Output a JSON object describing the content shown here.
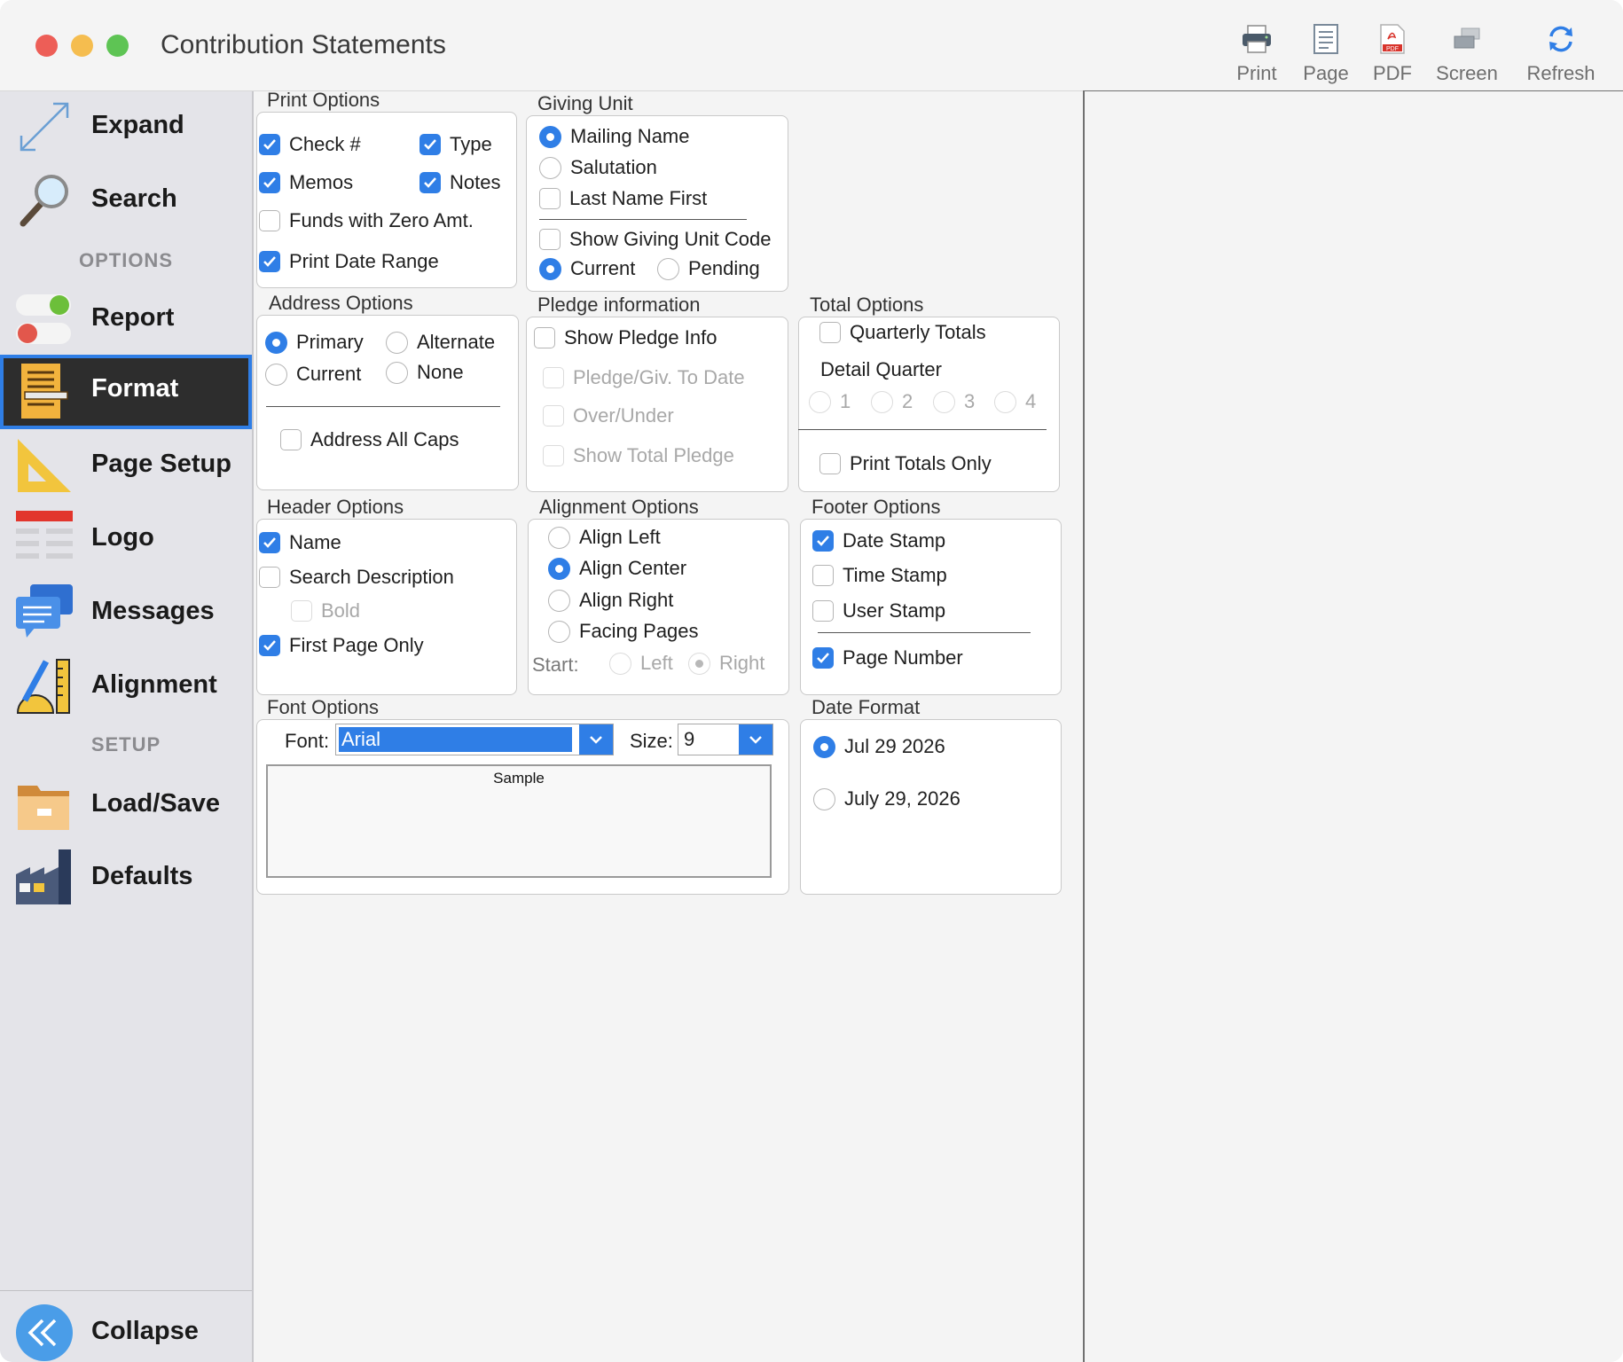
{
  "window": {
    "title": "Contribution Statements"
  },
  "toolbar": {
    "print": "Print",
    "page": "Page",
    "pdf": "PDF",
    "pdf_badge": "PDF",
    "screen": "Screen",
    "refresh": "Refresh"
  },
  "sidebar": {
    "expand": "Expand",
    "search": "Search",
    "options_header": "OPTIONS",
    "report": "Report",
    "format": "Format",
    "page_setup": "Page Setup",
    "logo": "Logo",
    "messages": "Messages",
    "alignment": "Alignment",
    "setup_header": "SETUP",
    "load_save": "Load/Save",
    "defaults": "Defaults",
    "collapse": "Collapse"
  },
  "print_options": {
    "title": "Print Options",
    "check_no": {
      "label": "Check #",
      "checked": true
    },
    "type": {
      "label": "Type",
      "checked": true
    },
    "memos": {
      "label": "Memos",
      "checked": true
    },
    "notes": {
      "label": "Notes",
      "checked": true
    },
    "zero_funds": {
      "label": "Funds with Zero Amt.",
      "checked": false
    },
    "print_date_range": {
      "label": "Print Date Range",
      "checked": true
    }
  },
  "giving_unit": {
    "title": "Giving Unit",
    "mailing_name": "Mailing Name",
    "salutation": "Salutation",
    "last_name_first": "Last Name First",
    "show_code": "Show Giving Unit Code",
    "current": "Current",
    "pending": "Pending"
  },
  "address_options": {
    "title": "Address Options",
    "primary": "Primary",
    "alternate": "Alternate",
    "current": "Current",
    "none": "None",
    "all_caps": "Address All Caps"
  },
  "pledge_info": {
    "title": "Pledge information",
    "show": "Show Pledge Info",
    "to_date": "Pledge/Giv. To Date",
    "over_under": "Over/Under",
    "show_total": "Show Total Pledge"
  },
  "total_options": {
    "title": "Total Options",
    "quarterly": "Quarterly Totals",
    "detail_quarter": "Detail Quarter",
    "q1": "1",
    "q2": "2",
    "q3": "3",
    "q4": "4",
    "print_totals_only": "Print Totals Only"
  },
  "header_options": {
    "title": "Header Options",
    "name": "Name",
    "search_desc": "Search Description",
    "bold": "Bold",
    "first_page_only": "First Page Only"
  },
  "alignment_options": {
    "title": "Alignment Options",
    "left": "Align Left",
    "center": "Align Center",
    "right": "Align Right",
    "facing": "Facing Pages",
    "start": "Start:",
    "start_left": "Left",
    "start_right": "Right"
  },
  "footer_options": {
    "title": "Footer Options",
    "date_stamp": "Date Stamp",
    "time_stamp": "Time Stamp",
    "user_stamp": "User Stamp",
    "page_number": "Page Number"
  },
  "font_options": {
    "title": "Font Options",
    "font_label": "Font:",
    "font_value": "Arial",
    "size_label": "Size:",
    "size_value": "9",
    "sample": "Sample"
  },
  "date_format": {
    "title": "Date Format",
    "short": "Jul 29 2026",
    "long": "July 29, 2026"
  },
  "colors": {
    "accent": "#2f7ee6",
    "sidebar_bg": "#e4e4e9",
    "selected_bg": "#2d2d2d"
  }
}
